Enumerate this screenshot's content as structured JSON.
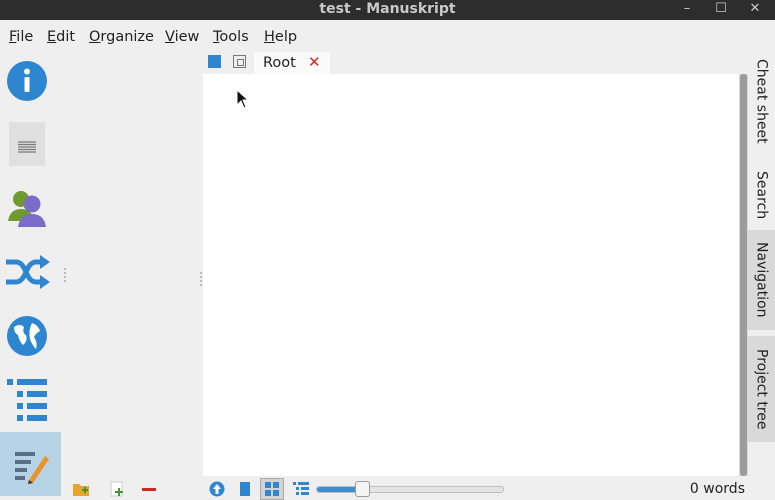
{
  "window": {
    "title": "test - Manuskript"
  },
  "menu": [
    {
      "label": "File"
    },
    {
      "label": "Edit"
    },
    {
      "label": "Organize"
    },
    {
      "label": "View"
    },
    {
      "label": "Tools"
    },
    {
      "label": "Help"
    }
  ],
  "sidebar": {
    "items": [
      {
        "icon": "info-icon"
      },
      {
        "icon": "summary-icon"
      },
      {
        "icon": "characters-icon"
      },
      {
        "icon": "plot-icon"
      },
      {
        "icon": "world-icon"
      },
      {
        "icon": "outline-icon"
      },
      {
        "icon": "editor-icon",
        "active": true
      }
    ]
  },
  "tabs": [
    {
      "label": "Root",
      "close": "✕"
    }
  ],
  "right_dock": {
    "tabs": [
      {
        "label": "Cheat sheet"
      },
      {
        "label": "Search"
      },
      {
        "label": "Navigation"
      },
      {
        "label": "Project tree"
      }
    ]
  },
  "status": {
    "word_count": "0 words",
    "zoom_fraction": 0.24
  },
  "colors": {
    "accent": "#2e86d0",
    "close": "#d42424",
    "active_item": "#b6d3e5"
  }
}
